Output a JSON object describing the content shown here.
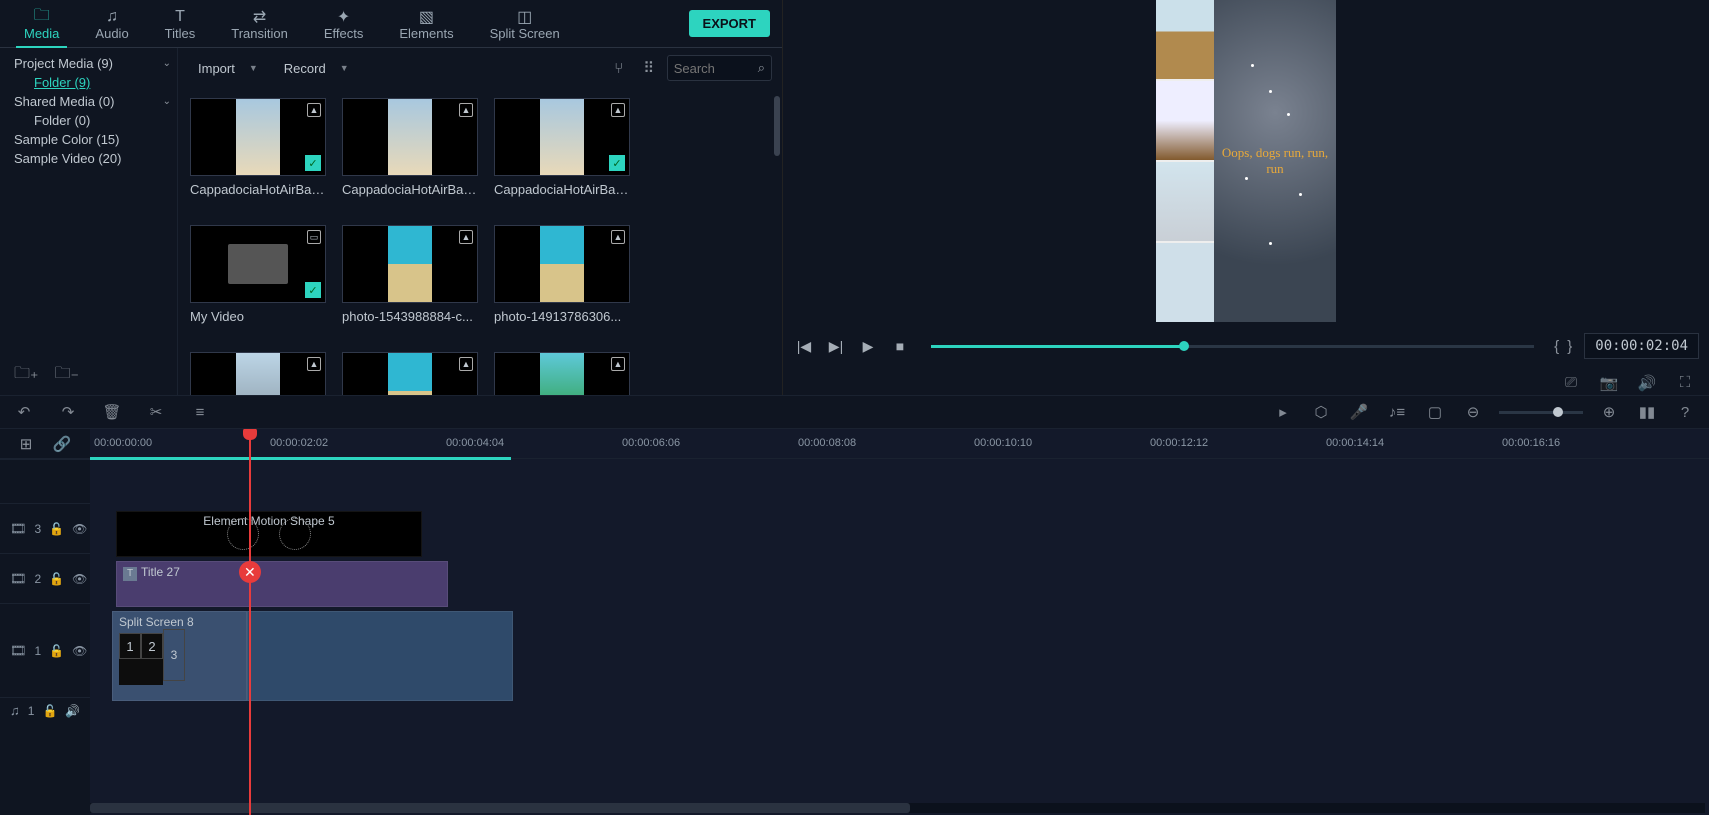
{
  "tabs": [
    "Media",
    "Audio",
    "Titles",
    "Transition",
    "Effects",
    "Elements",
    "Split Screen"
  ],
  "active_tab": "Media",
  "export_label": "EXPORT",
  "sidebar": [
    {
      "label": "Project Media (9)",
      "chev": true
    },
    {
      "label": "Folder (9)",
      "sub": true,
      "sel": true
    },
    {
      "label": "Shared Media (0)",
      "chev": true
    },
    {
      "label": "Folder (0)",
      "sub": true
    },
    {
      "label": "Sample Color (15)"
    },
    {
      "label": "Sample Video (20)"
    }
  ],
  "import_label": "Import",
  "record_label": "Record",
  "search_placeholder": "Search",
  "thumbs": [
    {
      "name": "CappadociaHotAirBall...",
      "type": "img",
      "check": true,
      "cls": "vert-strip"
    },
    {
      "name": "CappadociaHotAirBall...",
      "type": "img",
      "cls": "vert-strip"
    },
    {
      "name": "CappadociaHotAirBall...",
      "type": "img",
      "check": true,
      "cls": "vert-strip"
    },
    {
      "name": "My Video",
      "type": "vid",
      "check": true,
      "cls": "myv"
    },
    {
      "name": "photo-1543988884-c...",
      "type": "img",
      "cls": "beach"
    },
    {
      "name": "photo-14913786306...",
      "type": "img",
      "cls": "beach"
    },
    {
      "name": "",
      "type": "img",
      "cls": "coast"
    },
    {
      "name": "",
      "type": "img",
      "cls": "beach"
    },
    {
      "name": "",
      "type": "img",
      "cls": "palm"
    }
  ],
  "preview_text": "Oops, dogs\nrun, run, run",
  "timecode": "00:00:02:04",
  "progress_pct": 42,
  "ruler": [
    "00:00:00:00",
    "00:00:02:02",
    "00:00:04:04",
    "00:00:06:06",
    "00:00:08:08",
    "00:00:10:10",
    "00:00:12:12",
    "00:00:14:14",
    "00:00:16:16"
  ],
  "tracks": [
    {
      "id": "3",
      "icon": "🎞"
    },
    {
      "id": "2",
      "icon": "🎞"
    },
    {
      "id": "1",
      "icon": "🎞"
    },
    {
      "id": "1",
      "icon": "♫"
    }
  ],
  "clip_element": "Element Motion Shape 5",
  "clip_title": "Title 27",
  "clip_split": "Split Screen 8",
  "playhead_pct": 11,
  "in_range_pct": 26
}
